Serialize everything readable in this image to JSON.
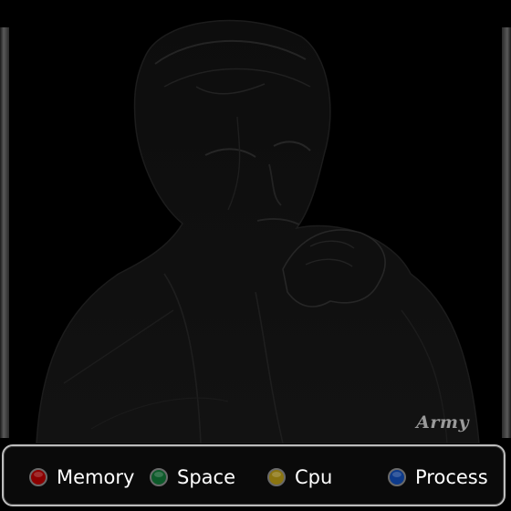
{
  "wallpaper": {
    "signature": "Army"
  },
  "stats_bar": {
    "items": [
      {
        "label": "Memory",
        "icon": "memory-indicator-icon",
        "color": "#8b0000"
      },
      {
        "label": "Space",
        "icon": "space-indicator-icon",
        "color": "#0d5a2a"
      },
      {
        "label": "Cpu",
        "icon": "cpu-indicator-icon",
        "color": "#8a7410"
      },
      {
        "label": "Process",
        "icon": "process-indicator-icon",
        "color": "#0d3a8a"
      }
    ]
  }
}
